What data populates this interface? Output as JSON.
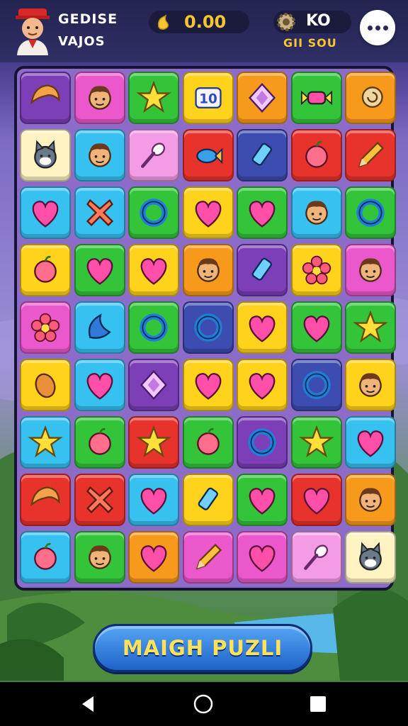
{
  "player": {
    "name": "GEDISE",
    "subtitle": "VAJOS"
  },
  "currency": {
    "coins": "0.00",
    "gear_label": "KO",
    "gear_sub": "GII SOU"
  },
  "action": {
    "label": "MAIGH PUZLI"
  },
  "board_label": "10",
  "colors": {
    "purple": "#7c3fb8",
    "pink": "#ea58cc",
    "green": "#33c43a",
    "yellow": "#ffd21c",
    "orange": "#f79a1b",
    "red": "#e8322c",
    "blue": "#36c1f1",
    "navy": "#3c4cb0",
    "cream": "#fff3c4",
    "lpink": "#f49be6"
  },
  "board": {
    "columns": 7,
    "rows": [
      [
        "purple:croissant-icon",
        "pink:character-icon",
        "green:star-icon",
        "yellow:number-icon",
        "orange:diamond-icon",
        "green:candy-icon",
        "orange:snail-icon"
      ],
      [
        "cream:cat-icon",
        "blue:character-icon",
        "lpink:spoon-icon",
        "red:fish-icon",
        "navy:drink-icon",
        "red:blob-icon",
        "red:pencil-icon"
      ],
      [
        "blue:heart-icon",
        "blue:cross-icon",
        "green:ring-icon",
        "yellow:heart-icon",
        "green:heart-icon",
        "blue:character-icon",
        "green:ring-icon"
      ],
      [
        "yellow:blob-icon",
        "green:heart-icon",
        "yellow:heart-icon",
        "orange:character-icon",
        "purple:drink-icon",
        "yellow:flower-icon",
        "pink:character-icon"
      ],
      [
        "pink:flower-icon",
        "blue:banana-icon",
        "green:ring-icon",
        "navy:ring-icon",
        "yellow:heart-icon",
        "green:heart-icon",
        "green:star-icon"
      ],
      [
        "yellow:bean-icon",
        "blue:heart-icon",
        "purple:diamond-icon",
        "yellow:heart-icon",
        "yellow:heart-icon",
        "navy:ring-icon",
        "yellow:character-icon"
      ],
      [
        "blue:star-icon",
        "green:blob-icon",
        "red:star-icon",
        "green:blob-icon",
        "purple:ring-icon",
        "green:star-icon",
        "blue:heart-icon"
      ],
      [
        "red:croissant-icon",
        "red:cross-icon",
        "blue:heart-icon",
        "yellow:drink-icon",
        "green:heart-icon",
        "red:heart-icon",
        "orange:character-icon"
      ],
      [
        "blue:blob-icon",
        "green:character-icon",
        "orange:heart-icon",
        "pink:pencil-icon",
        "pink:heart-icon",
        "lpink:spoon-icon",
        "cream:cat-icon"
      ]
    ]
  },
  "nav": {
    "back": "back-icon",
    "home": "home-icon",
    "recents": "recents-icon"
  }
}
